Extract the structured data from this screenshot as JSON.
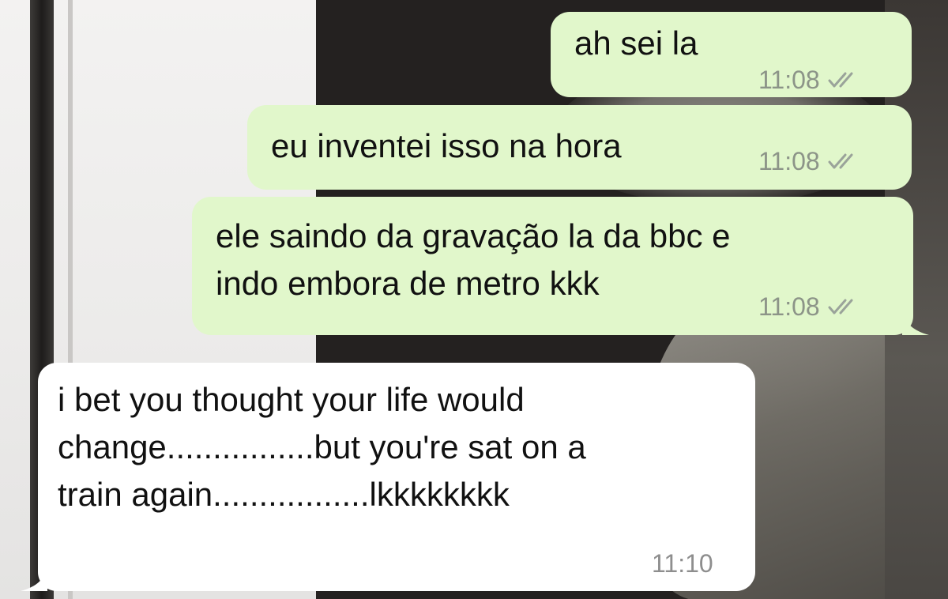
{
  "chat": {
    "messages": [
      {
        "direction": "outgoing",
        "text": "ah sei la",
        "time": "11:08",
        "status_icon": "double-check-icon"
      },
      {
        "direction": "outgoing",
        "text": "eu inventei isso na hora",
        "time": "11:08",
        "status_icon": "double-check-icon"
      },
      {
        "direction": "outgoing",
        "text": "ele saindo da gravação la da bbc e\nindo embora de metro kkk",
        "time": "11:08",
        "status_icon": "double-check-icon"
      },
      {
        "direction": "incoming",
        "text": "i bet you thought your life would\nchange................but you're sat on a\ntrain again.................lkkkkkkkk",
        "time": "11:10"
      }
    ]
  },
  "colors": {
    "outgoing_bubble": "#e1f7cb",
    "incoming_bubble": "#ffffff",
    "timestamp": "#8c9488"
  }
}
